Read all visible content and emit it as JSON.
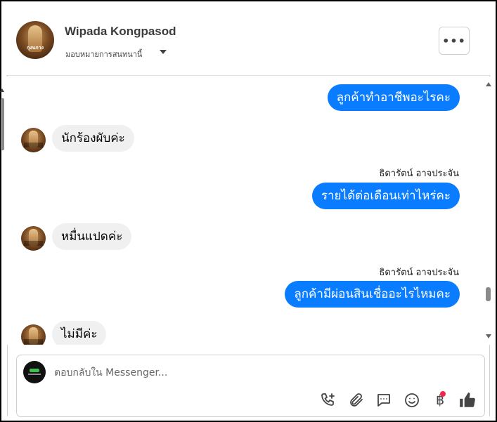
{
  "header": {
    "contact_name": "Wipada Kongpasod",
    "assign_label": "มอบหมายการสนทนานี้",
    "avatar_caption": "กุงนกาง",
    "more_label": "•••"
  },
  "messages": [
    {
      "direction": "out",
      "sender": "",
      "text": "ลูกค้าทำอาชีพอะไรคะ"
    },
    {
      "direction": "in",
      "sender": "",
      "text": "นักร้องผับค่ะ"
    },
    {
      "direction": "out",
      "sender": "ธิดารัตน์ อาจประจัน",
      "text": "รายได้ต่อเดือนเท่าไหร่คะ"
    },
    {
      "direction": "in",
      "sender": "",
      "text": "หมื่นแปดค่ะ"
    },
    {
      "direction": "out",
      "sender": "ธิดารัตน์ อาจประจัน",
      "text": "ลูกค้ามีผ่อนสินเชื่ออะไรไหมคะ"
    },
    {
      "direction": "in",
      "sender": "",
      "text": "ไม่มีค่ะ"
    }
  ],
  "composer": {
    "placeholder": "ตอบกลับใน Messenger..."
  },
  "toolbar": {
    "icons": [
      "phone-add-icon",
      "attachment-icon",
      "saved-reply-icon",
      "emoji-icon",
      "baht-payment-icon",
      "thumbs-up-icon"
    ],
    "payment_symbol": "฿"
  },
  "colors": {
    "outgoing_bubble": "#0a7cff",
    "incoming_bubble": "#f0f0f0",
    "notification_dot": "#f02849"
  }
}
